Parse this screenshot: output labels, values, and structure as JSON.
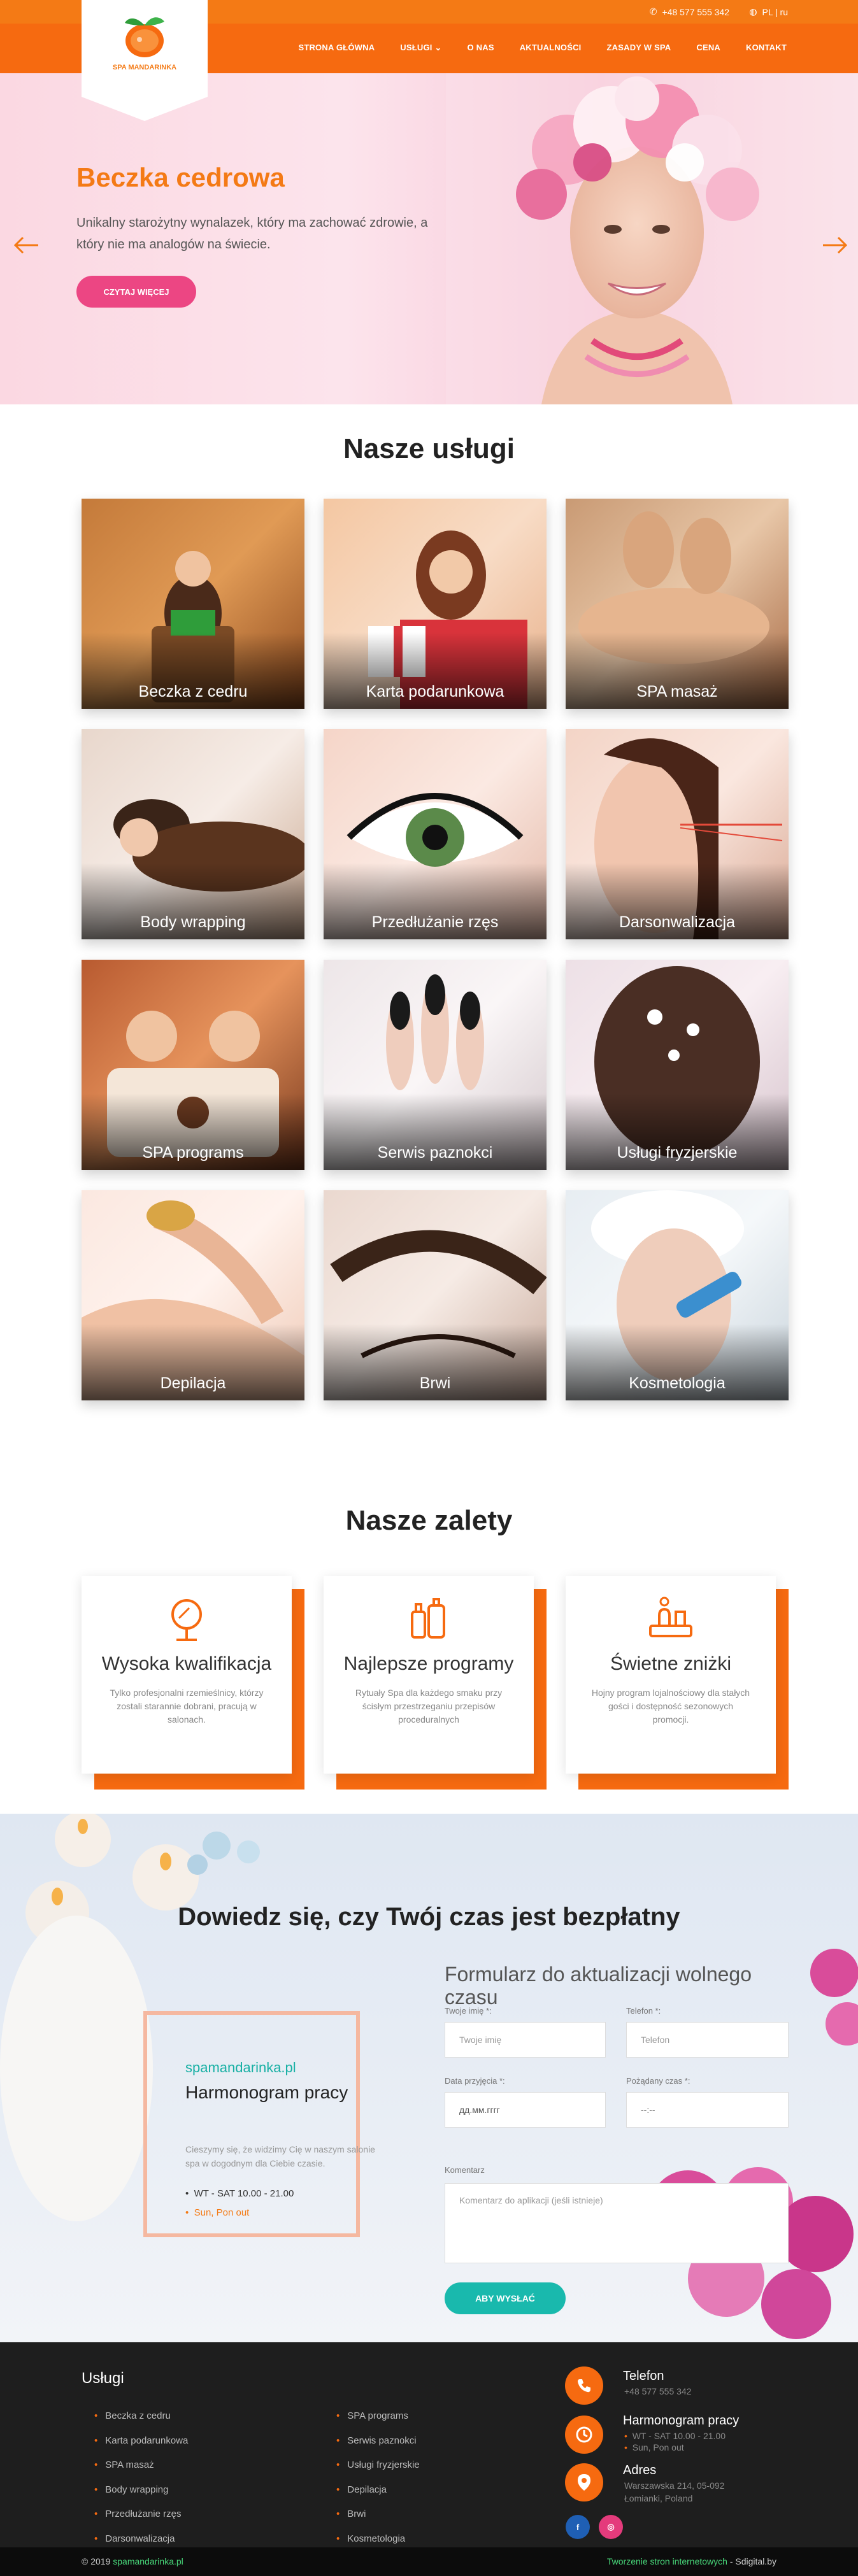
{
  "topbar": {
    "phone": "+48 577 555 342",
    "lang": "PL | ru"
  },
  "logo": {
    "text": "SPA MANDARINKA"
  },
  "nav": {
    "items": [
      "STRONA GŁÓWNA",
      "USŁUGI",
      "O NAS",
      "AKTUALNOŚCI",
      "ZASADY W SPA",
      "CENA",
      "KONTAKT"
    ]
  },
  "hero": {
    "title": "Beczka cedrowa",
    "text": "Unikalny starożytny wynalazek, który ma zachować zdrowie, a który nie ma analogów na świecie.",
    "button": "CZYTAJ WIĘCEJ"
  },
  "services": {
    "title": "Nasze usługi",
    "items": [
      "Beczka z cedru",
      "Karta podarunkowa",
      "SPA masaż",
      "Body wrapping",
      "Przedłużanie rzęs",
      "Darsonwalizacja",
      "SPA programs",
      "Serwis paznokci",
      "Usługi fryzjerskie",
      "Depilacja",
      "Brwi",
      "Kosmetologia"
    ]
  },
  "advantages": {
    "title": "Nasze zalety",
    "items": [
      {
        "title": "Wysoka kwalifikacja",
        "text": "Tylko profesjonalni rzemieślnicy, którzy zostali starannie dobrani, pracują w salonach."
      },
      {
        "title": "Najlepsze programy",
        "text": "Rytuały Spa dla każdego smaku przy ścisłym przestrzeganiu przepisów proceduralnych"
      },
      {
        "title": "Świetne zniżki",
        "text": "Hojny program lojalnościowy dla stałych gości i dostępność sezonowych promocji."
      }
    ]
  },
  "booking": {
    "title": "Dowiedz się, czy Twój czas jest bezpłatny",
    "schedule": {
      "site": "spamandarinka.pl",
      "title": "Harmonogram pracy",
      "text": "Cieszymy się, że widzimy Cię w naszym salonie spa w dogodnym dla Ciebie czasie.",
      "hours": "WT - SAT 10.00 - 21.00",
      "closed": "Sun, Pon out"
    },
    "form": {
      "title": "Formularz do aktualizacji wolnego czasu",
      "name_label": "Twoje imię *:",
      "name_placeholder": "Twoje imię",
      "phone_label": "Telefon *:",
      "phone_placeholder": "Telefon",
      "date_label": "Data przyjęcia *:",
      "date_placeholder": "дд.мм.гггг",
      "time_label": "Pożądany czas *:",
      "time_placeholder": "--:--",
      "comment_label": "Komentarz",
      "comment_placeholder": "Komentarz do aplikacji (jeśli istnieje)",
      "submit": "ABY WYSŁAĆ"
    }
  },
  "footer": {
    "services_title": "Usługi",
    "col1": [
      "Beczka z cedru",
      "Karta podarunkowa",
      "SPA masaż",
      "Body wrapping",
      "Przedłużanie rzęs",
      "Darsonwalizacja"
    ],
    "col2": [
      "SPA programs",
      "Serwis paznokci",
      "Usługi fryzjerskie",
      "Depilacja",
      "Brwi",
      "Kosmetologia"
    ],
    "phone_title": "Telefon",
    "phone": "+48 577 555 342",
    "hours_title": "Harmonogram pracy",
    "hours1": "WT - SAT 10.00 - 21.00",
    "hours2": "Sun, Pon out",
    "addr_title": "Adres",
    "addr1": "Warszawska 214, 05-092",
    "addr2": "Łomianki, Poland",
    "social": [
      "f",
      "◎"
    ]
  },
  "bottom": {
    "copyright": "© 2019",
    "site": "spamandarinka.pl",
    "credit_link": "Tworzenie stron internetowych",
    "credit": " - Sdigital.by"
  },
  "colors": {
    "accent": "#f66a10",
    "pink": "#ec4683",
    "teal": "#19b9ad"
  }
}
